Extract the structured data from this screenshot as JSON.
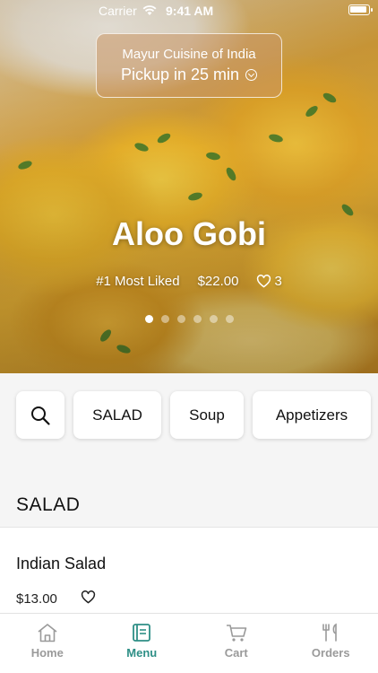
{
  "status_bar": {
    "carrier": "Carrier",
    "time": "9:41 AM"
  },
  "pickup": {
    "restaurant": "Mayur Cuisine of India",
    "eta": "Pickup in 25 min"
  },
  "hero": {
    "title": "Aloo Gobi",
    "rank": "#1 Most Liked",
    "price": "$22.00",
    "likes": "3",
    "carousel": {
      "total": 6,
      "active": 1
    }
  },
  "categories": [
    "SALAD",
    "Soup",
    "Appetizers"
  ],
  "section": {
    "title": "SALAD",
    "items": [
      {
        "name": "Indian Salad",
        "price": "$13.00"
      }
    ]
  },
  "tabs": [
    {
      "label": "Home",
      "icon": "home-icon",
      "active": false
    },
    {
      "label": "Menu",
      "icon": "menu-icon",
      "active": true
    },
    {
      "label": "Cart",
      "icon": "cart-icon",
      "active": false
    },
    {
      "label": "Orders",
      "icon": "orders-icon",
      "active": false
    }
  ],
  "colors": {
    "accent": "#2e8f86"
  }
}
